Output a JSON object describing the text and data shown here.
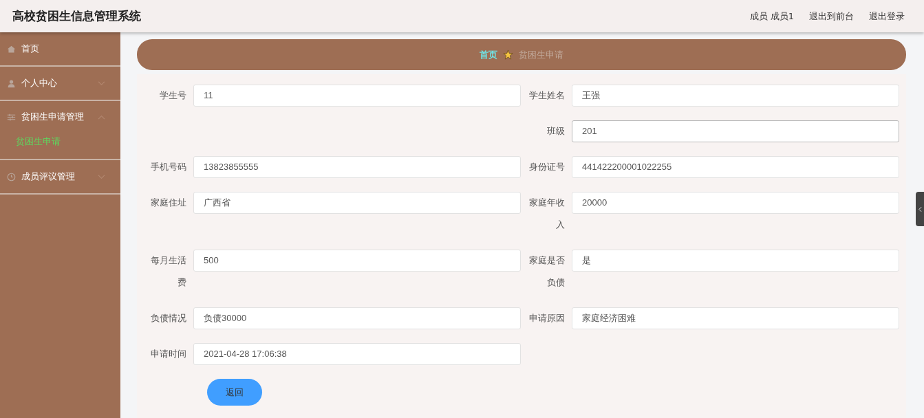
{
  "header": {
    "title": "高校贫困生信息管理系统",
    "user": "成员 成员1",
    "links": [
      "退出到前台",
      "退出登录"
    ]
  },
  "sidebar": {
    "items": [
      {
        "label": "首页",
        "kind": "link"
      },
      {
        "label": "个人中心",
        "kind": "submenu",
        "expanded": false
      },
      {
        "label": "贫困生申请管理",
        "kind": "submenu",
        "expanded": true,
        "children": [
          {
            "label": "贫困生申请",
            "selected": true
          }
        ]
      },
      {
        "label": "成员评议管理",
        "kind": "submenu",
        "expanded": false
      }
    ]
  },
  "breadcrumb": {
    "home": "首页",
    "current": "贫困生申请"
  },
  "form": {
    "rows": [
      {
        "left": {
          "label": "学生号",
          "value": "11",
          "focused": false
        },
        "right": {
          "label": "学生姓名",
          "value": "王强",
          "focused": false
        }
      },
      {
        "right": {
          "label": "班级",
          "value": "201",
          "focused": true
        }
      },
      {
        "left": {
          "label": "手机号码",
          "value": "13823855555",
          "focused": false
        },
        "right": {
          "label": "身份证号",
          "value": "441422200001022255",
          "focused": false
        }
      },
      {
        "left": {
          "label": "家庭住址",
          "value": "广西省",
          "focused": false
        },
        "right": {
          "label": "家庭年收入",
          "value": "20000",
          "focused": false
        }
      },
      {
        "left": {
          "label": "每月生活费",
          "value": "500",
          "focused": false
        },
        "right": {
          "label": "家庭是否负债",
          "value": "是",
          "focused": false
        }
      },
      {
        "left": {
          "label": "负债情况",
          "value": "负债30000",
          "focused": false
        },
        "right": {
          "label": "申请原因",
          "value": "家庭经济困难",
          "focused": false
        }
      },
      {
        "left": {
          "label": "申请时间",
          "value": "2021-04-28 17:06:38",
          "focused": false
        }
      }
    ],
    "button": "返回"
  }
}
